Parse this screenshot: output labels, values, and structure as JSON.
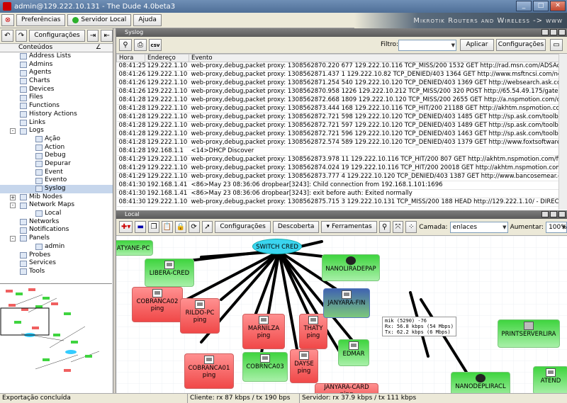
{
  "window": {
    "title": "admin@129.222.10.131 - The Dude 4.0beta3"
  },
  "toolbar": {
    "prefs": "Preferências",
    "server": "Servidor Local",
    "help": "Ajuda"
  },
  "banner": "Mikrotik Routers and Wireless -> www",
  "left": {
    "config_btn": "Configurações",
    "header": "Conteúdos",
    "tree": [
      {
        "label": "Address Lists",
        "level": 1
      },
      {
        "label": "Admins",
        "level": 1
      },
      {
        "label": "Agents",
        "level": 1
      },
      {
        "label": "Charts",
        "level": 1
      },
      {
        "label": "Devices",
        "level": 1
      },
      {
        "label": "Files",
        "level": 1
      },
      {
        "label": "Functions",
        "level": 1
      },
      {
        "label": "History Actions",
        "level": 1
      },
      {
        "label": "Links",
        "level": 1
      },
      {
        "label": "Logs",
        "level": 1,
        "expander": "-"
      },
      {
        "label": "Ação",
        "level": 2
      },
      {
        "label": "Action",
        "level": 2
      },
      {
        "label": "Debug",
        "level": 2
      },
      {
        "label": "Depurar",
        "level": 2
      },
      {
        "label": "Event",
        "level": 2
      },
      {
        "label": "Evento",
        "level": 2
      },
      {
        "label": "Syslog",
        "level": 2,
        "selected": true
      },
      {
        "label": "Mib Nodes",
        "level": 1,
        "expander": "+"
      },
      {
        "label": "Network Maps",
        "level": 1,
        "expander": "-"
      },
      {
        "label": "Local",
        "level": 2
      },
      {
        "label": "Networks",
        "level": 1
      },
      {
        "label": "Notifications",
        "level": 1
      },
      {
        "label": "Panels",
        "level": 1,
        "expander": "-"
      },
      {
        "label": "admin",
        "level": 2
      },
      {
        "label": "Probes",
        "level": 1
      },
      {
        "label": "Services",
        "level": 1
      },
      {
        "label": "Tools",
        "level": 1
      }
    ]
  },
  "syslog": {
    "panel_title": "Syslog",
    "filter_label": "Filtro:",
    "apply": "Aplicar",
    "config": "Configurações",
    "columns": [
      "Hora",
      "Endereço",
      "Evento"
    ],
    "rows": [
      [
        "08:41:25",
        "129.222.1.10",
        "web-proxy,debug,packet proxy: 1308562870.220    677 129.222.10.116 TCP_MISS/200 1532 GET http://rad.msn.com/ADSAdCl..."
      ],
      [
        "08:41:26",
        "129.222.1.10",
        "web-proxy,debug,packet proxy: 1308562871.437      1 129.222.10.82 TCP_DENIED/403 1364 GET http://www.msftncsi.com/nc..."
      ],
      [
        "08:41:26",
        "129.222.1.10",
        "web-proxy,debug,packet proxy: 1308562871.254    540 129.222.10.120 TCP_DENIED/403 1369 GET http://websearch.ask.co..."
      ],
      [
        "08:41:26",
        "129.222.1.10",
        "web-proxy,debug,packet proxy: 1308562870.958   1226 129.222.10.212 TCP_MISS/200 320 POST http://65.54.49.175/gatewa..."
      ],
      [
        "08:41:28",
        "129.222.1.10",
        "web-proxy,debug,packet proxy: 1308562872.668   1809 129.222.10.120 TCP_MISS/200 2655 GET http://a.nspmotion.com/deli..."
      ],
      [
        "08:41:28",
        "129.222.1.10",
        "web-proxy,debug,packet proxy: 1308562873.444    168 129.222.10.116 TCP_HIT/200 21188 GET http://akhtm.nspmotion.com/f..."
      ],
      [
        "08:41:28",
        "129.222.1.10",
        "web-proxy,debug,packet proxy: 1308562872.721    598 129.222.10.120 TCP_DENIED/403 1485 GET http://sp.ask.com/toolbar..."
      ],
      [
        "08:41:28",
        "129.222.1.10",
        "web-proxy,debug,packet proxy: 1308562872.721    597 129.222.10.120 TCP_DENIED/403 1489 GET http://sp.ask.com/toolbar..."
      ],
      [
        "08:41:28",
        "129.222.1.10",
        "web-proxy,debug,packet proxy: 1308562872.721    596 129.222.10.120 TCP_DENIED/403 1463 GET http://sp.ask.com/toolbar..."
      ],
      [
        "08:41:28",
        "129.222.1.10",
        "web-proxy,debug,packet proxy: 1308562872.574    589 129.222.10.120 TCP_DENIED/403 1379 GET http://www.foxtsoftware...."
      ],
      [
        "08:41:28",
        "192.168.1.1",
        "<14>DHCP Discover"
      ],
      [
        "08:41:29",
        "129.222.1.10",
        "web-proxy,debug,packet proxy: 1308562873.978     11 129.222.10.116 TCP_HIT/200 807 GET http://akhtm.nspmotion.com/files..."
      ],
      [
        "08:41:29",
        "129.222.1.10",
        "web-proxy,debug,packet proxy: 1308562874.024     19 129.222.10.116 TCP_HIT/200 20018 GET http://akhtm.nspmotion.com/fi..."
      ],
      [
        "08:41:29",
        "129.222.1.10",
        "web-proxy,debug,packet proxy: 1308562873.777      4 129.222.10.120 TCP_DENIED/403 1387 GET http://www.bancosemear.c..."
      ],
      [
        "08:41:30",
        "192.168.1.41",
        "<86>May 23 08:36:06 dropbear[3243]: Child connection from 192.168.1.101:1696"
      ],
      [
        "08:41:30",
        "192.168.1.41",
        "<86>May 23 08:36:06 dropbear[3243]: exit before auth: Exited normally"
      ],
      [
        "08:41:30",
        "129.222.1.10",
        "web-proxy,debug,packet proxy: 1308562875.715      3 129.222.10.131 TCP_MISS/200 188 HEAD http://129.222.1.10/ - DIREC..."
      ]
    ]
  },
  "local": {
    "panel_title": "Local",
    "config": "Configurações",
    "discover": "Descoberta",
    "tools": "Ferramentas",
    "layer_label": "Camada:",
    "layer_value": "enlaces",
    "zoom_label": "Aumentar:",
    "zoom_value": "100%",
    "nodes": {
      "switch": "SWITCH CRED",
      "atyane": "ATYANE-PC",
      "libera": "LIBERA-CRED",
      "cobranca02": "COBRANCA02",
      "rildo": "RILDO-PC",
      "marnilza": "MARNILZA",
      "thaty": "THATY",
      "janyara_fin": "JANYARA-FIN",
      "nanolira": "NANOLIRADEPAP",
      "cobranca01": "COBRANCA01",
      "cobrnca03": "COBRNCA03",
      "dayse": "DAYSE",
      "edmar": "EDMAR",
      "janyara_card": "JANYARA-CARD",
      "nanodepli": "NANODEPLIRACL",
      "printserver": "PRINTSERVERLIRA",
      "atend": "ATEND",
      "ping": "ping"
    },
    "link_label": [
      "mik (5290) -76",
      "Rx: 56.8 kbps (54 Mbps)",
      "Tx: 62.2 kbps (6 Mbps)"
    ]
  },
  "status": {
    "left": "Exportação concluída",
    "client": "Cliente: rx 87 kbps / tx 190 bps",
    "server": "Servidor: rx 37.9 kbps / tx 111 kbps"
  }
}
